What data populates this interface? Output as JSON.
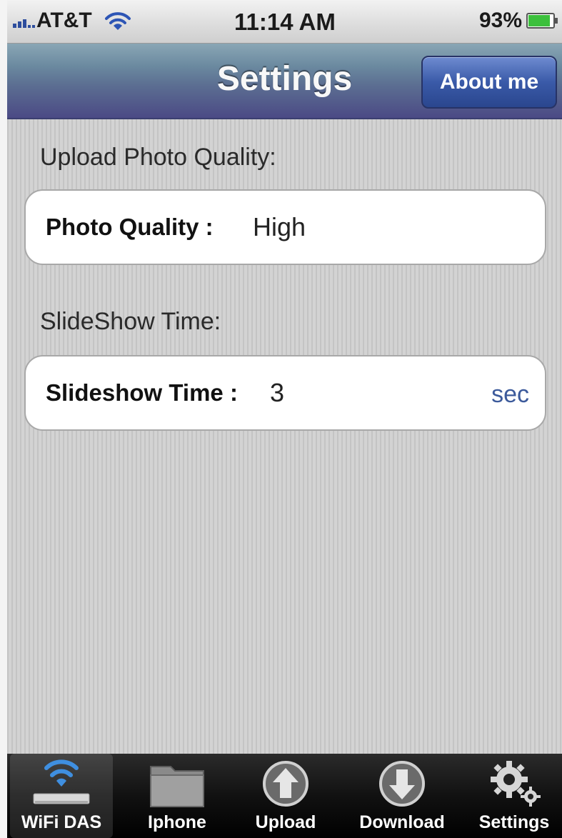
{
  "status_bar": {
    "carrier": "AT&T",
    "time": "11:14 AM",
    "battery_percent": "93%",
    "battery_level": 0.93,
    "icons": [
      "signal-icon",
      "wifi-icon",
      "battery-icon"
    ]
  },
  "navbar": {
    "title": "Settings",
    "about_button": "About me"
  },
  "sections": {
    "upload_label": "Upload Photo Quality:",
    "photo_quality": {
      "label": "Photo Quality :",
      "value": "High"
    },
    "slideshow_label": "SlideShow Time:",
    "slideshow_time": {
      "label": "Slideshow Time :",
      "value": "3",
      "unit": "sec"
    }
  },
  "tabbar": {
    "tabs": [
      {
        "label": "WiFi DAS",
        "icon": "wifi-icon",
        "active": true
      },
      {
        "label": "Iphone",
        "icon": "folder-icon",
        "active": false
      },
      {
        "label": "Upload",
        "icon": "upload-arrow-icon",
        "active": false
      },
      {
        "label": "Download",
        "icon": "download-arrow-icon",
        "active": false
      },
      {
        "label": "Settings",
        "icon": "gears-icon",
        "active": false
      }
    ]
  },
  "colors": {
    "nav_gradient_top": "#8aa6b5",
    "nav_gradient_bottom": "#4b4a85",
    "about_button": "#3a5aa8",
    "unit_text": "#3c5a9b",
    "battery_fill": "#3cc03c"
  }
}
